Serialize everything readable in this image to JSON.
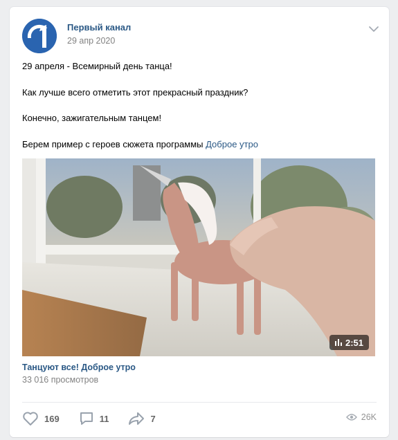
{
  "post": {
    "author": "Первый канал",
    "date": "29 апр 2020",
    "avatar_icon": "channel-one-logo",
    "menu_icon": "chevron-down-icon",
    "text_lines": [
      "29 апреля - Всемирный день танца!",
      "Как лучше всего отметить этот прекрасный праздник?",
      "Конечно, зажигательным танцем!"
    ],
    "last_line_text": "Берем пример с героев сюжета программы ",
    "last_line_link": "Доброе утро"
  },
  "video": {
    "duration": "2:51",
    "title": "Танцуют все! Доброе утро",
    "views": "33 016 просмотров"
  },
  "actions": {
    "likes": "169",
    "comments": "11",
    "shares": "7",
    "views": "26K"
  },
  "colors": {
    "link": "#2a5885",
    "brand": "#2a64b0",
    "background": "#edeef0"
  }
}
